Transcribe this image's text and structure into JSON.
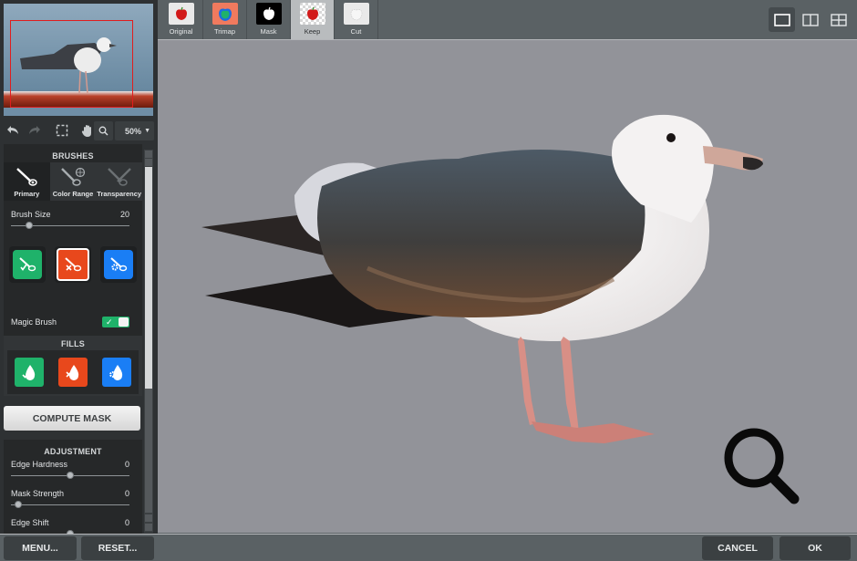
{
  "navigator": {
    "zoom_level": "50%"
  },
  "toolbar": {
    "undo_icon": "undo-arrow",
    "redo_icon": "redo-arrow",
    "select_icon": "dashed-rectangle",
    "pan_icon": "hand",
    "zoom_icon": "magnifier"
  },
  "brushes": {
    "title": "BRUSHES",
    "tabs": [
      {
        "label": "Primary",
        "active": true
      },
      {
        "label": "Color Range",
        "active": false
      },
      {
        "label": "Transparency",
        "active": false
      }
    ],
    "brush_size": {
      "label": "Brush Size",
      "value": "20",
      "fraction": 0.15
    },
    "modes": [
      {
        "name": "keep-brush",
        "color": "#1fb26a"
      },
      {
        "name": "remove-brush",
        "color": "#e8481c",
        "selected": true
      },
      {
        "name": "auto-brush",
        "color": "#1a7ef5"
      }
    ],
    "magic_brush": {
      "label": "Magic Brush",
      "on": true
    }
  },
  "fills": {
    "title": "FILLS",
    "items": [
      {
        "name": "keep-fill",
        "color": "#1fb26a"
      },
      {
        "name": "remove-fill",
        "color": "#e8481c"
      },
      {
        "name": "auto-fill",
        "color": "#1a7ef5"
      }
    ]
  },
  "compute_mask_label": "COMPUTE MASK",
  "adjustment": {
    "title": "ADJUSTMENT",
    "sliders": [
      {
        "label": "Edge Hardness",
        "value": "0",
        "fraction": 0.5
      },
      {
        "label": "Mask Strength",
        "value": "0",
        "fraction": 0.06
      },
      {
        "label": "Edge Shift",
        "value": "0",
        "fraction": 0.5
      }
    ]
  },
  "view_tabs": [
    {
      "label": "Original",
      "active": false
    },
    {
      "label": "Trimap",
      "active": false
    },
    {
      "label": "Mask",
      "active": false
    },
    {
      "label": "Keep",
      "active": true
    },
    {
      "label": "Cut",
      "active": false
    }
  ],
  "layouts": [
    {
      "name": "single-view",
      "active": true
    },
    {
      "name": "split-view",
      "active": false
    },
    {
      "name": "quad-view",
      "active": false
    }
  ],
  "footer": {
    "menu_label": "MENU...",
    "reset_label": "RESET...",
    "cancel_label": "CANCEL",
    "ok_label": "OK"
  },
  "colors": {
    "keep": "#1fb26a",
    "remove": "#e8481c",
    "auto": "#1a7ef5",
    "nav_frame": "#e11d1d"
  }
}
